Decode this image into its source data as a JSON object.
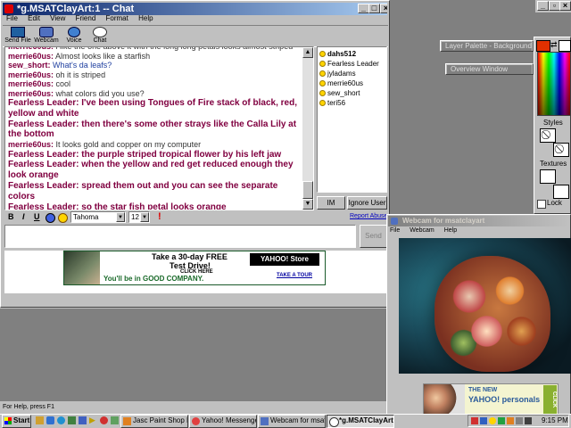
{
  "chat_window": {
    "title": "*g.MSATClayArt:1 -- Chat",
    "menu": [
      "File",
      "Edit",
      "View",
      "Friend",
      "Format",
      "Help"
    ],
    "toolbar": [
      "Send File",
      "Webcam",
      "Voice",
      "Chat"
    ],
    "messages": [
      {
        "user": "merrie60us:",
        "text": "i like the one above it with the long long petals looks almost striped",
        "style": "small"
      },
      {
        "user": "merrie60us:",
        "text": "Almost looks like a starfish",
        "style": "small"
      },
      {
        "user": "sew_short:",
        "text": "What's da leafs?",
        "style": "small"
      },
      {
        "user": "merrie60us:",
        "text": "oh it is striped",
        "style": "small"
      },
      {
        "user": "merrie60us:",
        "text": "cool",
        "style": "small"
      },
      {
        "user": "merrie60us:",
        "text": "what colors did you use?",
        "style": "small"
      },
      {
        "user": "Fearless Leader:",
        "text": "I've been using Tongues of Fire stack of black, red, yellow and white",
        "style": "big"
      },
      {
        "user": "Fearless Leader:",
        "text": "then there's some other strays like the Calla Lily at the bottom",
        "style": "big"
      },
      {
        "user": "merrie60us:",
        "text": "It looks gold and copper on my computer",
        "style": "small"
      },
      {
        "user": "Fearless Leader:",
        "text": "the purple striped tropical flower by his left jaw",
        "style": "big"
      },
      {
        "user": "Fearless Leader:",
        "text": "when the yellow and red get reduced enough they look orange",
        "style": "big"
      },
      {
        "user": "Fearless Leader:",
        "text": "spread them out and you can see the separate colors",
        "style": "big"
      },
      {
        "user": "Fearless Leader:",
        "text": "so the star fish petal looks orange",
        "style": "big"
      }
    ],
    "members": [
      "dahs512",
      "Fearless Leader",
      "jyladams",
      "merrie60us",
      "sew_short",
      "teri56"
    ],
    "im_button": "IM",
    "ignore_button": "Ignore User",
    "format_bar": {
      "bold": "B",
      "italic": "I",
      "underline": "U",
      "font": "Tahoma",
      "size": "12"
    },
    "report_abuse": "Report Abuse",
    "send_button": "Send",
    "input_value": "",
    "ad": {
      "line1": "Take a 30-day FREE",
      "line2": "Test Drive!",
      "click": "CLICK HERE",
      "brand": "YAHOO! Store",
      "tagline": "You'll be in GOOD COMPANY.",
      "tour": "TAKE A TOUR"
    }
  },
  "status_bar": {
    "text": "For Help, press F1"
  },
  "paint_shop": {
    "layer_palette": "Layer Palette - Background",
    "overview": "Overview Window",
    "styles_label": "Styles",
    "textures_label": "Textures",
    "lock_label": "Lock",
    "colors": {
      "fore": "#e03000",
      "back": "#ffffff"
    }
  },
  "webcam_window": {
    "title": "Webcam for msatclayart",
    "menu": [
      "File",
      "Webcam",
      "Help"
    ]
  },
  "personals_ad": {
    "line1": "THE NEW",
    "brand": "YAHOO! personals",
    "click": "CLICK"
  },
  "taskbar": {
    "start": "Start",
    "tasks": [
      {
        "label": "Jasc Paint Shop P...",
        "active": false
      },
      {
        "label": "Yahoo! Messenger",
        "active": false
      },
      {
        "label": "Webcam for msat...",
        "active": false
      },
      {
        "label": "*g.MSATClayArt...",
        "active": true
      }
    ],
    "clock": "9:15 PM"
  }
}
